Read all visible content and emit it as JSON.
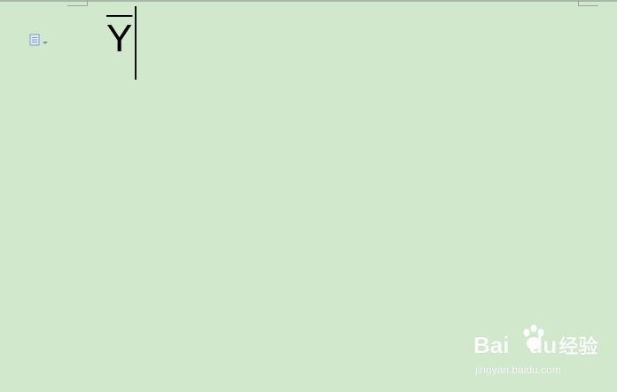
{
  "document": {
    "text_char": "Y"
  },
  "paste_options": {
    "icon": "clipboard-icon",
    "dropdown_icon": "triangle-down-icon"
  },
  "watermark": {
    "logo_prefix": "Bai",
    "logo_suffix": "du",
    "logo_cn": "经验",
    "url": "jingyan.baidu.com"
  },
  "colors": {
    "page_background": "#d1e8cd",
    "icon_blue": "#7f9fc6",
    "text": "#000000",
    "watermark": "#ffffff"
  }
}
